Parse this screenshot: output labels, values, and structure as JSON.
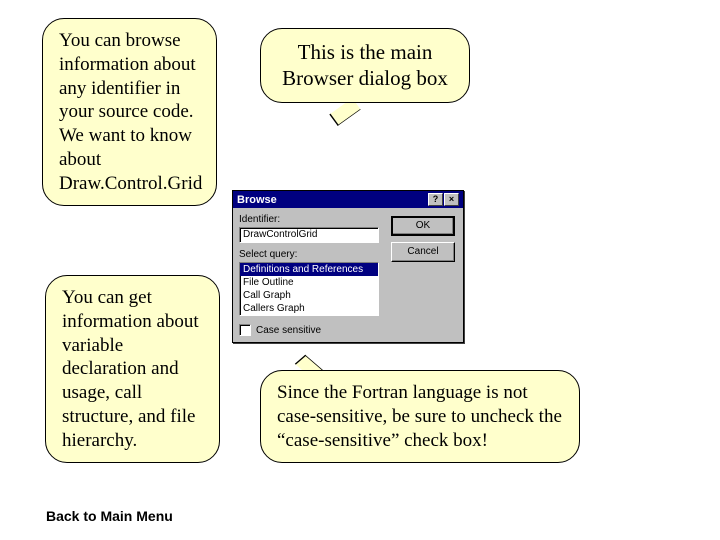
{
  "callouts": {
    "c1": "You can browse information about any identifier in your source code.  We want to know about Draw.Control.Grid",
    "c2": "This is the main Browser dialog box",
    "c3": "You can get information about variable declaration and usage, call structure, and file hierarchy.",
    "c4": "Since the Fortran language is not case-sensitive, be sure to uncheck the “case-sensitive” check box!"
  },
  "back_link": "Back to Main Menu",
  "dialog": {
    "title": "Browse",
    "help_glyph": "?",
    "close_glyph": "×",
    "identifier_label": "Identifier:",
    "identifier_value": "DrawControlGrid",
    "query_label": "Select query:",
    "list": {
      "i0": "Definitions and References",
      "i1": "File Outline",
      "i2": "Call Graph",
      "i3": "Callers Graph"
    },
    "ok": "OK",
    "cancel": "Cancel",
    "case_label": "Case sensitive"
  }
}
